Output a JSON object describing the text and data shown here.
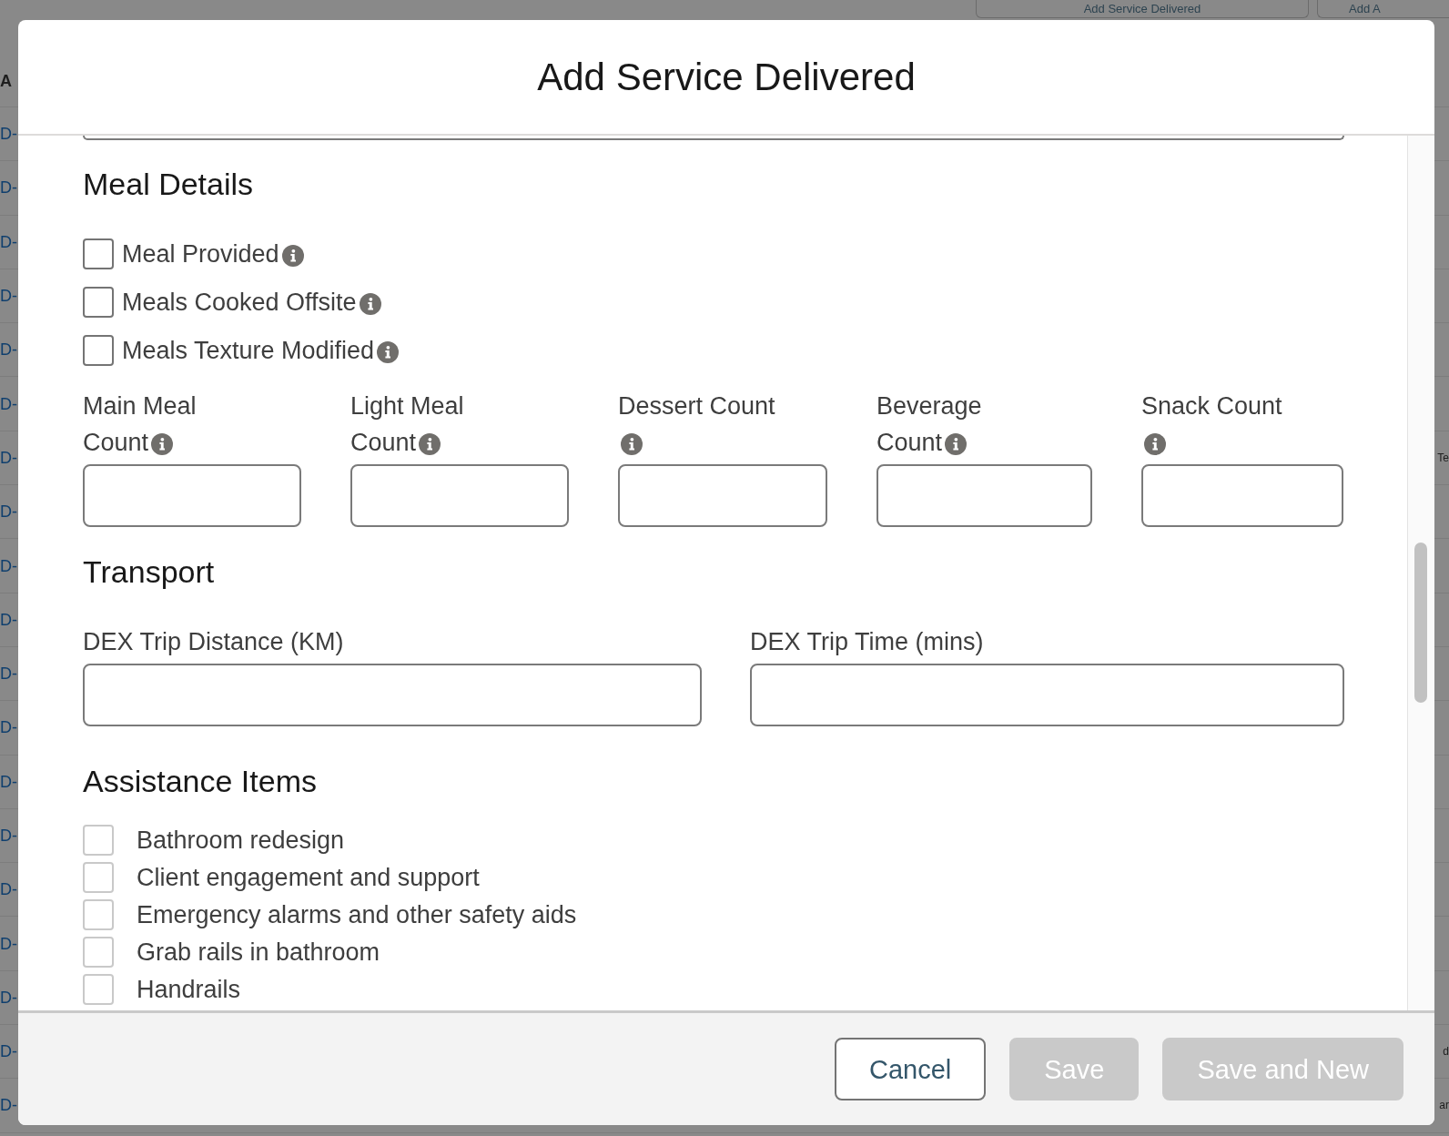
{
  "backdrop": {
    "buttons": [
      "Add Service Delivered",
      "Add A"
    ],
    "table": {
      "header": "A",
      "rows": [
        {
          "left_cell": "D-"
        },
        {
          "left_cell": "D-"
        },
        {
          "left_cell": "D-"
        },
        {
          "left_cell": "D-"
        },
        {
          "left_cell": "D-"
        },
        {
          "left_cell": "D-"
        },
        {
          "left_cell": "D-",
          "right_cell": "Te"
        },
        {
          "left_cell": "D-"
        },
        {
          "left_cell": "D-"
        },
        {
          "left_cell": "D-"
        },
        {
          "left_cell": "D-"
        },
        {
          "left_cell": "D-"
        },
        {
          "left_cell": "D-"
        },
        {
          "left_cell": "D-"
        },
        {
          "left_cell": "D-"
        },
        {
          "left_cell": "D-"
        },
        {
          "left_cell": "D-"
        },
        {
          "left_cell": "D-",
          "right_cell": "d"
        },
        {
          "left_cell": "D-",
          "right_cell": "ar"
        }
      ]
    }
  },
  "modal": {
    "title": "Add Service Delivered"
  },
  "meal_details": {
    "title": "Meal Details",
    "checkboxes": [
      {
        "label": "Meal Provided",
        "checked": false,
        "info": true
      },
      {
        "label": "Meals Cooked Offsite",
        "checked": false,
        "info": true
      },
      {
        "label": "Meals Texture Modified",
        "checked": false,
        "info": true
      }
    ],
    "count_fields": [
      {
        "label": "Main Meal Count",
        "info": true
      },
      {
        "label": "Light Meal Count",
        "info": true
      },
      {
        "label": "Dessert Count",
        "info": true
      },
      {
        "label": "Beverage Count",
        "info": true
      },
      {
        "label": "Snack Count",
        "info": true
      }
    ]
  },
  "transport": {
    "title": "Transport",
    "fields": [
      {
        "label": "DEX Trip Distance (KM)",
        "info": false
      },
      {
        "label": "DEX Trip Time (mins)",
        "info": false
      }
    ]
  },
  "assistance_items": {
    "title": "Assistance Items",
    "items": [
      {
        "label": "Bathroom redesign",
        "checked": false
      },
      {
        "label": "Client engagement and support",
        "checked": false
      },
      {
        "label": "Emergency alarms and other safety aids",
        "checked": false
      },
      {
        "label": "Grab rails in bathroom",
        "checked": false
      },
      {
        "label": "Handrails",
        "checked": false
      }
    ]
  },
  "footer": {
    "buttons": [
      {
        "label": "Cancel",
        "kind": "neutral",
        "disabled": false
      },
      {
        "label": "Save",
        "kind": "brand",
        "disabled": true
      },
      {
        "label": "Save and New",
        "kind": "brand",
        "disabled": true
      }
    ]
  }
}
